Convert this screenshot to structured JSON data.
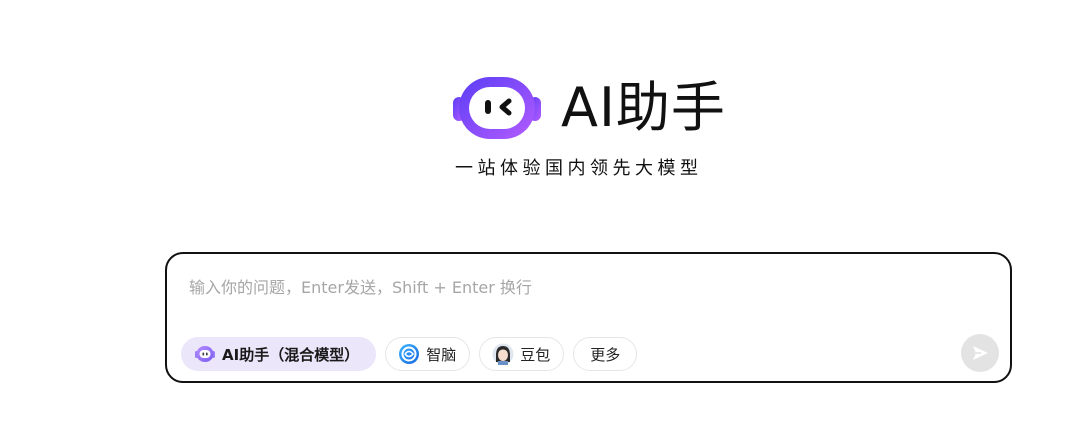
{
  "brand": {
    "name": "AI助手",
    "tagline": "一站体验国内领先大模型"
  },
  "chat": {
    "placeholder": "输入你的问题，Enter发送，Shift + Enter 换行",
    "value": ""
  },
  "models": [
    {
      "label": "AI助手（混合模型）",
      "icon": "robot-icon",
      "selected": true
    },
    {
      "label": "智脑",
      "icon": "zhinao-icon",
      "selected": false
    },
    {
      "label": "豆包",
      "icon": "doubao-avatar-icon",
      "selected": false
    },
    {
      "label": "更多",
      "icon": "",
      "selected": false
    }
  ],
  "send": {
    "icon": "send-arrow-icon",
    "enabled": false
  },
  "colors": {
    "brand_gradient_start": "#6a4cff",
    "brand_gradient_end": "#b15cff",
    "selected_chip_bg": "#ece6fb",
    "send_disabled": "#e3e3e3"
  }
}
